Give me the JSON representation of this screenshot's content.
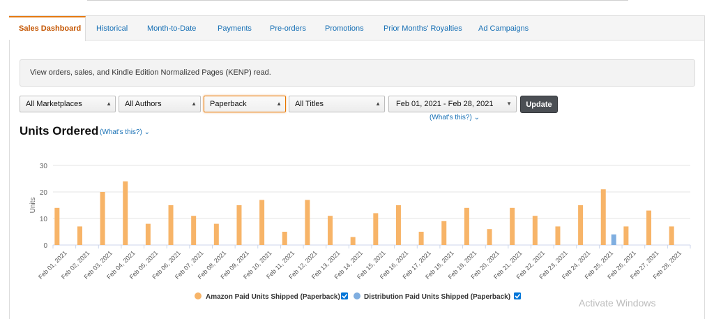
{
  "tabs": [
    {
      "label": "Sales Dashboard",
      "active": true
    },
    {
      "label": "Historical",
      "active": false
    },
    {
      "label": "Month-to-Date",
      "active": false
    },
    {
      "label": "Payments",
      "active": false
    },
    {
      "label": "Pre-orders",
      "active": false
    },
    {
      "label": "Promotions",
      "active": false
    },
    {
      "label": "Prior Months' Royalties",
      "active": false
    },
    {
      "label": "Ad Campaigns",
      "active": false
    }
  ],
  "info_text": "View orders, sales, and Kindle Edition Normalized Pages (KENP) read.",
  "filters": {
    "marketplace": "All Marketplaces",
    "authors": "All Authors",
    "format": "Paperback",
    "titles": "All Titles",
    "date_range": "Feb 01, 2021 - Feb 28, 2021"
  },
  "update_label": "Update",
  "whats_this": "(What's this?)",
  "chart_heading": "Units Ordered",
  "watermark": "Activate Windows",
  "colors": {
    "accent": "#e47911",
    "series_amazon": "#f7b468",
    "series_distribution": "#7faee0",
    "link": "#146eb4"
  },
  "chart_data": {
    "type": "bar",
    "categories": [
      "Feb 01, 2021",
      "Feb 02, 2021",
      "Feb 03, 2021",
      "Feb 04, 2021",
      "Feb 05, 2021",
      "Feb 06, 2021",
      "Feb 07, 2021",
      "Feb 08, 2021",
      "Feb 09, 2021",
      "Feb 10, 2021",
      "Feb 11, 2021",
      "Feb 12, 2021",
      "Feb 13, 2021",
      "Feb 14, 2021",
      "Feb 15, 2021",
      "Feb 16, 2021",
      "Feb 17, 2021",
      "Feb 18, 2021",
      "Feb 19, 2021",
      "Feb 20, 2021",
      "Feb 21, 2021",
      "Feb 22, 2021",
      "Feb 23, 2021",
      "Feb 24, 2021",
      "Feb 25, 2021",
      "Feb 26, 2021",
      "Feb 27, 2021",
      "Feb 28, 2021"
    ],
    "series": [
      {
        "name": "Amazon Paid Units Shipped (Paperback)",
        "color": "#f7b468",
        "checked": true,
        "values": [
          14,
          7,
          20,
          24,
          8,
          15,
          11,
          8,
          15,
          17,
          5,
          17,
          11,
          3,
          12,
          15,
          5,
          9,
          14,
          6,
          14,
          11,
          7,
          15,
          21,
          7,
          13,
          7
        ]
      },
      {
        "name": "Distribution Paid Units Shipped (Paperback)",
        "color": "#7faee0",
        "checked": true,
        "values": [
          0,
          0,
          0,
          0,
          0,
          0,
          0,
          0,
          0,
          0,
          0,
          0,
          0,
          0,
          0,
          0,
          0,
          0,
          0,
          0,
          0,
          0,
          0,
          0,
          4,
          0,
          0,
          0
        ]
      }
    ],
    "ylabel": "Units",
    "ylim": [
      0,
      30
    ],
    "yticks": [
      0,
      10,
      20,
      30
    ],
    "grid": true,
    "legend": "bottom"
  }
}
